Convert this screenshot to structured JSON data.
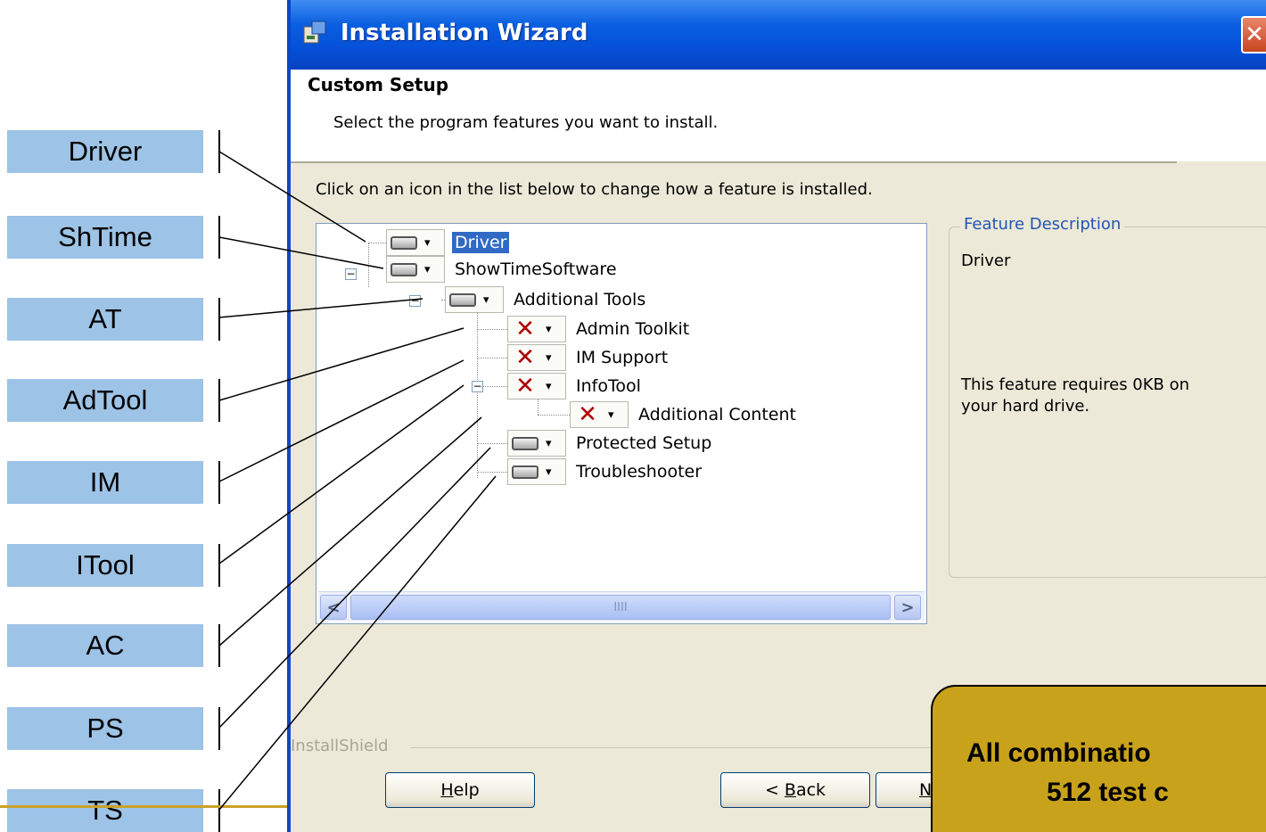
{
  "callout_labels": [
    {
      "key": "driver",
      "text": "Driver"
    },
    {
      "key": "shtime",
      "text": "ShTime"
    },
    {
      "key": "at",
      "text": "AT"
    },
    {
      "key": "adtool",
      "text": "AdTool"
    },
    {
      "key": "im",
      "text": "IM"
    },
    {
      "key": "itool",
      "text": "ITool"
    },
    {
      "key": "ac",
      "text": "AC"
    },
    {
      "key": "ps",
      "text": "PS"
    },
    {
      "key": "ts",
      "text": "TS"
    }
  ],
  "window": {
    "title": "Installation Wizard",
    "close_glyph": "✕",
    "icon": "installer-icon"
  },
  "header": {
    "title": "Custom Setup",
    "subtitle": "Select the program features you want to install."
  },
  "instructions": "Click on an icon in the list below to change how a feature is installed.",
  "tree": {
    "nodes": [
      {
        "label": "Driver",
        "state": "install",
        "selected": true
      },
      {
        "label": "ShowTimeSoftware",
        "state": "install",
        "selected": false
      },
      {
        "label": "Additional Tools",
        "state": "install",
        "selected": false
      },
      {
        "label": "Admin Toolkit",
        "state": "unavailable",
        "selected": false
      },
      {
        "label": "IM Support",
        "state": "unavailable",
        "selected": false
      },
      {
        "label": "InfoTool",
        "state": "unavailable",
        "selected": false
      },
      {
        "label": "Additional Content",
        "state": "unavailable",
        "selected": false
      },
      {
        "label": "Protected Setup",
        "state": "install",
        "selected": false
      },
      {
        "label": "Troubleshooter",
        "state": "install",
        "selected": false
      }
    ],
    "dropdown_arrow": "▾",
    "x_glyph": "✕",
    "scroll_left": "<",
    "scroll_right": ">",
    "scroll_grip": "IIII"
  },
  "feature_description": {
    "legend": "Feature Description",
    "name": "Driver",
    "requirement": "This feature requires 0KB on your hard drive."
  },
  "footer": {
    "brand": "InstallShield",
    "help": {
      "before": "",
      "mnemonic": "H",
      "after": "elp"
    },
    "back": {
      "before": "< ",
      "mnemonic": "B",
      "after": "ack"
    },
    "next": {
      "before": "",
      "mnemonic": "N",
      "after": ""
    }
  },
  "note": {
    "line1": "All combinatio",
    "line2": "512 test c"
  },
  "colors": {
    "label_fill": "#9dc3e6",
    "titlebar": "#0550d8",
    "note_fill": "#c9a21c",
    "selection": "#316ac5",
    "x_mark": "#b00000"
  }
}
